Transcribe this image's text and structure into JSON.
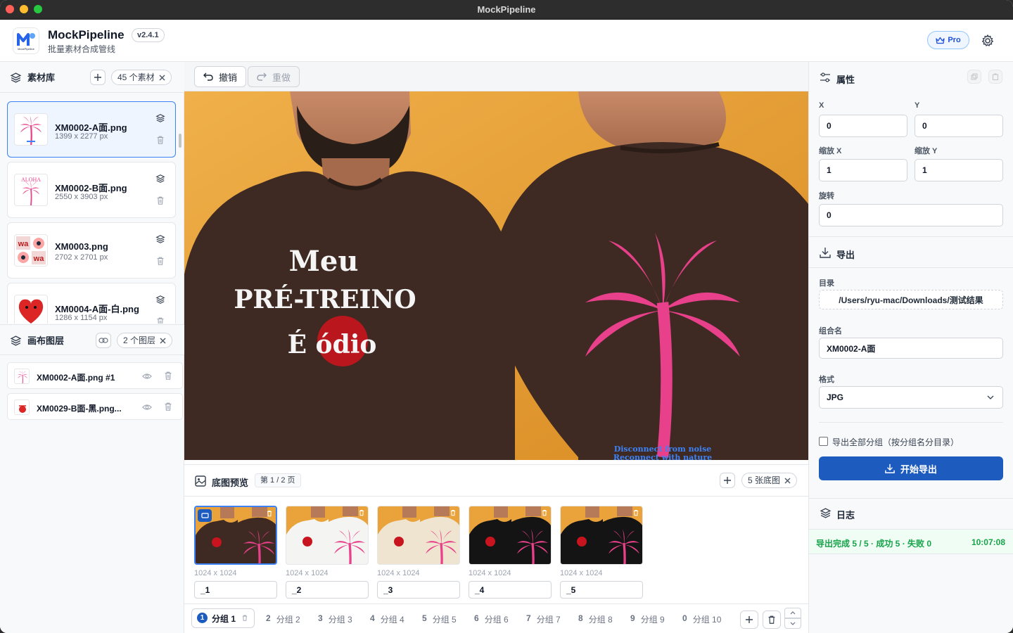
{
  "window": {
    "title": "MockPipeline"
  },
  "header": {
    "app_name": "MockPipeline",
    "version": "v2.4.1",
    "subtitle": "批量素材合成管线",
    "pro_label": "Pro",
    "logo_text": "MockPipeline"
  },
  "assets": {
    "title": "素材库",
    "count_label": "45 个素材",
    "items": [
      {
        "name": "XM0002-A面.png",
        "dims": "1399 x 2277 px"
      },
      {
        "name": "XM0002-B面.png",
        "dims": "2550 x 3903 px",
        "thumb_text": "ALOHA"
      },
      {
        "name": "XM0003.png",
        "dims": "2702 x 2701 px",
        "thumb_text": "wa"
      },
      {
        "name": "XM0004-A面-白.png",
        "dims": "1286 x 1154 px"
      }
    ]
  },
  "layers": {
    "title": "画布图层",
    "count_label": "2 个图层",
    "items": [
      {
        "name": "XM0002-A面.png #1"
      },
      {
        "name": "XM0029-B面-黑.png..."
      }
    ]
  },
  "toolbar": {
    "undo_label": "撤销",
    "redo_label": "重做"
  },
  "canvas": {
    "front_print_lines": [
      "Meu",
      "PRÉ-TREINO",
      "É ódio"
    ],
    "back_print_lines": [
      "Disconnect from noise",
      "Reconnect with nature"
    ],
    "colors": {
      "backdrop": "#e9a33a",
      "shirt": "#3e2a22",
      "palm": "#e8408a"
    }
  },
  "preview": {
    "title": "底图预览",
    "page_label": "第 1 / 2 页",
    "count_label": "5 张底图",
    "items": [
      {
        "dims": "1024 x 1024",
        "name": "_1",
        "shirt_color": "#3e2a22"
      },
      {
        "dims": "1024 x 1024",
        "name": "_2",
        "shirt_color": "#f4f4f2"
      },
      {
        "dims": "1024 x 1024",
        "name": "_3",
        "shirt_color": "#efe4cf"
      },
      {
        "dims": "1024 x 1024",
        "name": "_4",
        "shirt_color": "#141414"
      },
      {
        "dims": "1024 x 1024",
        "name": "_5",
        "shirt_color": "#141414"
      }
    ]
  },
  "groups": {
    "items": [
      {
        "key": "1",
        "label": "分组 1"
      },
      {
        "key": "2",
        "label": "分组 2"
      },
      {
        "key": "3",
        "label": "分组 3"
      },
      {
        "key": "4",
        "label": "分组 4"
      },
      {
        "key": "5",
        "label": "分组 5"
      },
      {
        "key": "6",
        "label": "分组 6"
      },
      {
        "key": "7",
        "label": "分组 7"
      },
      {
        "key": "8",
        "label": "分组 8"
      },
      {
        "key": "9",
        "label": "分组 9"
      },
      {
        "key": "0",
        "label": "分组 10"
      }
    ]
  },
  "properties": {
    "title": "属性",
    "x_label": "X",
    "x_value": "0",
    "y_label": "Y",
    "y_value": "0",
    "scale_x_label": "缩放 X",
    "scale_x_value": "1",
    "scale_y_label": "缩放 Y",
    "scale_y_value": "1",
    "rotation_label": "旋转",
    "rotation_value": "0"
  },
  "export": {
    "title": "导出",
    "dir_label": "目录",
    "dir_value": "/Users/ryu-mac/Downloads/测试结果",
    "group_name_label": "组合名",
    "group_name_value": "XM0002-A面",
    "format_label": "格式",
    "format_value": "JPG",
    "export_all_label": "导出全部分组（按分组名分目录）",
    "start_label": "开始导出"
  },
  "log": {
    "title": "日志",
    "message": "导出完成 5 / 5 · 成功 5 · 失败 0",
    "time": "10:07:08"
  },
  "colors": {
    "accent": "#1d5bbf",
    "selection": "#3b82f6",
    "success": "#16a34a"
  }
}
